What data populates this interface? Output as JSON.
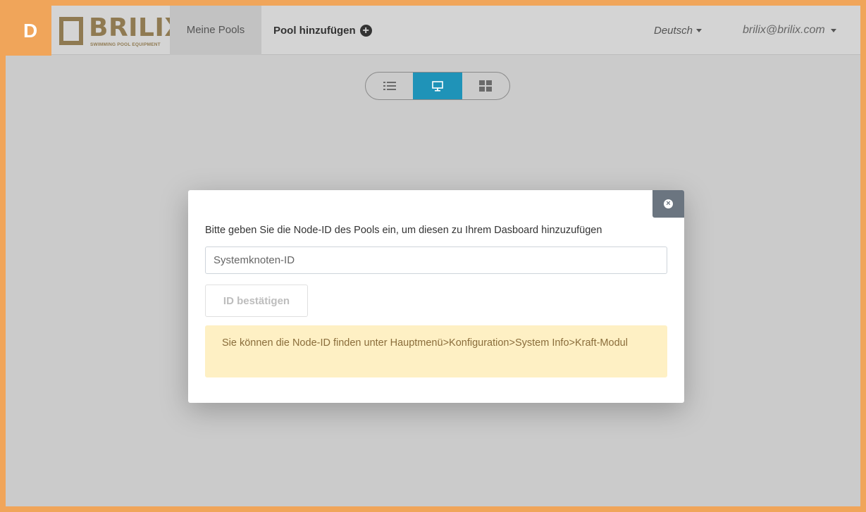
{
  "badge": {
    "letter": "D"
  },
  "logo": {
    "name": "BRILIX",
    "tagline": "SWIMMING POOL EQUIPMENT"
  },
  "navbar": {
    "meine_pools": "Meine Pools",
    "pool_hinzufuegen": "Pool hinzufügen",
    "language": "Deutsch",
    "user": "brilix@brilix.com"
  },
  "view_toggle": {
    "options": [
      "list-view",
      "desktop-view",
      "grid-view"
    ],
    "active": "desktop-view"
  },
  "modal": {
    "message": "Bitte geben Sie die Node-ID des Pools ein, um diesen zu Ihrem Dasboard hinzuzufügen",
    "input_placeholder": "Systemknoten-ID",
    "input_value": "",
    "confirm_label": "ID bestätigen",
    "info": "Sie können die Node-ID finden unter Hauptmenü>Konfiguration>System Info>Kraft-Modul"
  },
  "colors": {
    "accent": "#1f93b8",
    "frame": "#f0a55a",
    "alert_bg": "#fef0c4",
    "alert_text": "#8a6d3b",
    "brand": "#8f7a52"
  }
}
